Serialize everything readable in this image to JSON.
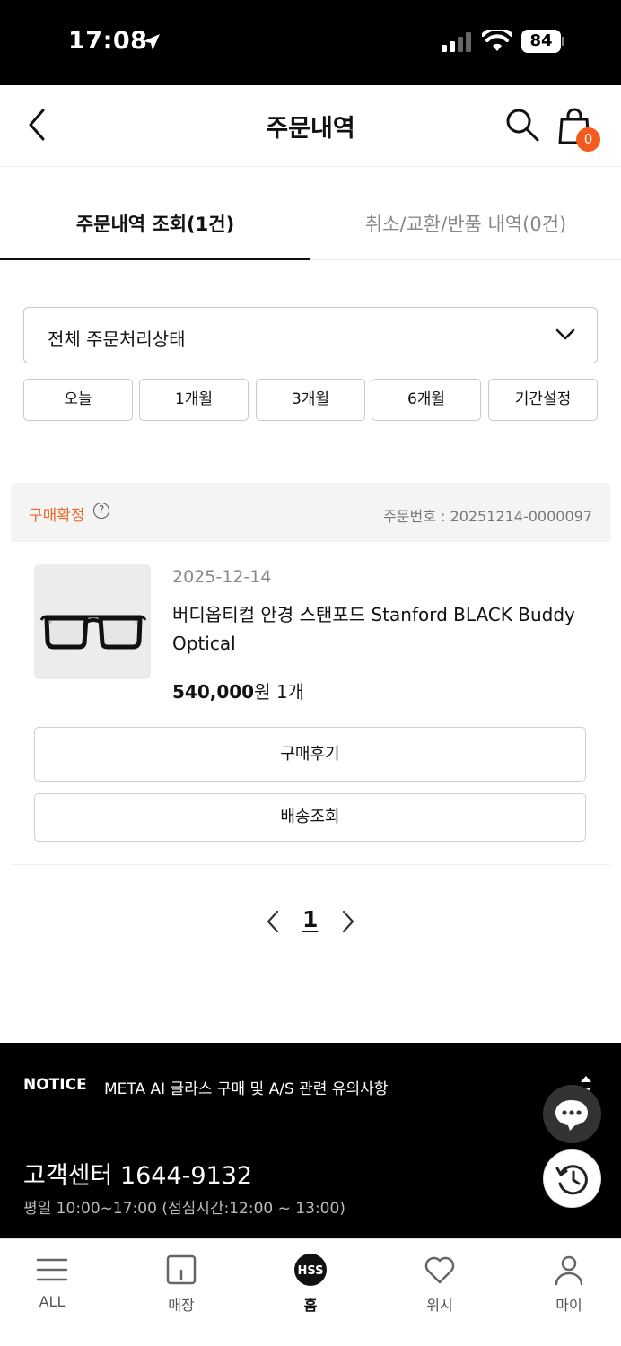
{
  "status_bar": {
    "time": "17:08",
    "battery": "84"
  },
  "header": {
    "title": "주문내역",
    "cart_count": "0"
  },
  "tabs": [
    {
      "label": "주문내역 조회(1건)",
      "active": true
    },
    {
      "label": "취소/교환/반품 내역(0건)",
      "active": false
    }
  ],
  "filter": {
    "status_select": "전체 주문처리상태",
    "periods": [
      "오늘",
      "1개월",
      "3개월",
      "6개월",
      "기간설정"
    ]
  },
  "order": {
    "status": "구매확정",
    "order_number": "주문번호 : 20251214-0000097",
    "date": "2025-12-14",
    "product_name": "버디옵티컬 안경 스탠포드 Stanford BLACK Buddy Optical",
    "price": "540,000",
    "price_unit": "원",
    "quantity": "1개",
    "review_button": "구매후기",
    "shipping_button": "배송조회"
  },
  "pagination": {
    "current": "1"
  },
  "footer": {
    "notice_label": "NOTICE",
    "notice_text": "META AI 글라스 구매 및 A/S 관련 유의사항",
    "cs_title": "고객센터 1644-9132",
    "cs_hours": "평일 10:00~17:00 (점심시간:12:00 ~ 13:00)"
  },
  "bottom_nav": [
    {
      "label": "ALL",
      "icon": "menu-icon"
    },
    {
      "label": "매장",
      "icon": "store-icon"
    },
    {
      "label": "홈",
      "icon": "home-logo-icon",
      "logo_text": "HSS"
    },
    {
      "label": "위시",
      "icon": "heart-icon"
    },
    {
      "label": "마이",
      "icon": "person-icon"
    }
  ],
  "colors": {
    "accent": "#f06424",
    "badge": "#f45a1e",
    "footer_bg": "#000000"
  }
}
